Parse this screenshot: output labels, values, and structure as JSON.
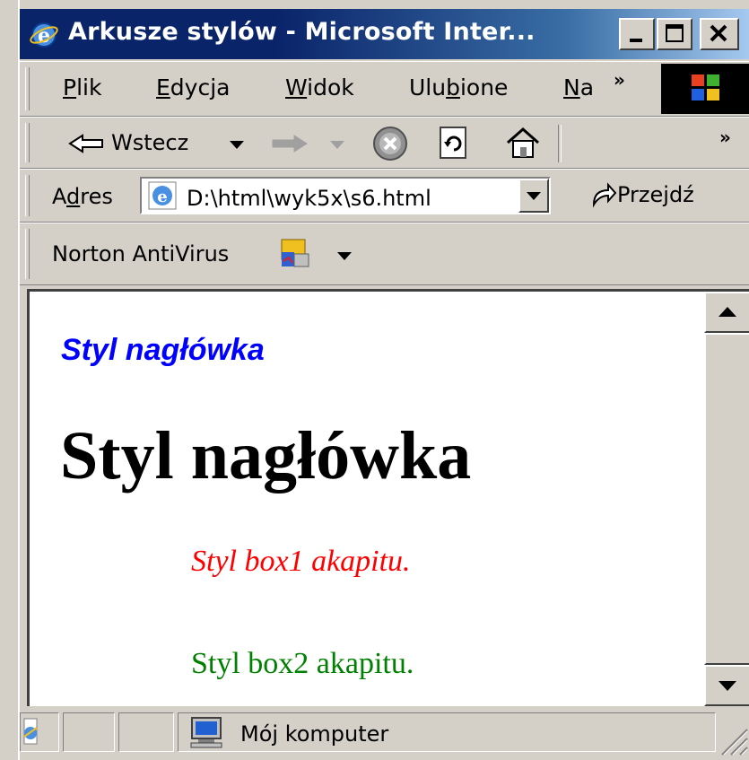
{
  "window": {
    "title": "Arkusze stylów - Microsoft Inter..."
  },
  "menu": {
    "items": [
      {
        "label": "Plik",
        "accel": "P",
        "rest": "lik"
      },
      {
        "label": "Edycja",
        "accel": "E",
        "rest": "dycja"
      },
      {
        "label": "Widok",
        "accel": "W",
        "rest": "idok"
      },
      {
        "label": "Ulubione",
        "pre": "Ulu",
        "accel": "b",
        "rest": "ione"
      },
      {
        "label": "Na",
        "accel": "N",
        "rest": "a"
      }
    ],
    "overflow": "»"
  },
  "toolbar": {
    "back_label": "Wstecz",
    "overflow": "»",
    "icons": [
      "back-arrow-icon",
      "forward-arrow-icon",
      "stop-icon",
      "refresh-icon",
      "home-icon"
    ]
  },
  "address": {
    "label": "Adres",
    "label_accel": "d",
    "value": "D:\\html\\wyk5x\\s6.html",
    "go_label": "Przejdź"
  },
  "norton": {
    "label": "Norton AntiVirus"
  },
  "page": {
    "heading_small": "Styl nagłówka",
    "heading_big": "Styl nagłówka",
    "para_box1": "Styl box1 akapitu.",
    "para_box2": "Styl box2 akapitu.",
    "colors": {
      "heading_small": "#0000ff",
      "heading_big": "#000000",
      "box1": "#ff0000",
      "box2": "#008000"
    }
  },
  "status": {
    "zone": "Mój komputer"
  }
}
